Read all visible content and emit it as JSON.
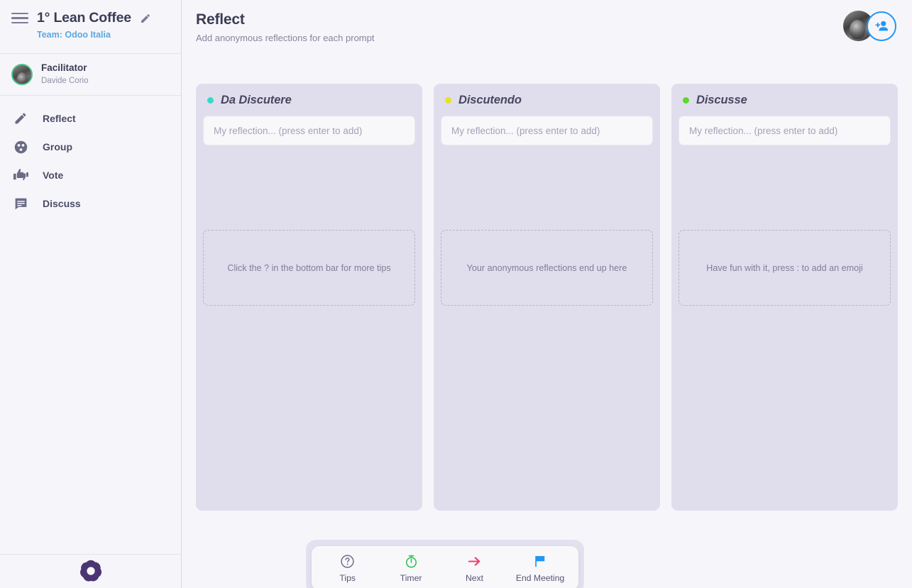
{
  "sidebar": {
    "menu_icon": "hamburger-icon",
    "meeting_title": "1° Lean Coffee",
    "edit_icon": "pencil-icon",
    "team_label": "Team: Odoo Italia",
    "facilitator": {
      "role": "Facilitator",
      "name": "Davide Corio",
      "avatar": "user-avatar"
    },
    "nav_items": [
      {
        "label": "Reflect",
        "icon": "pencil-icon"
      },
      {
        "label": "Group",
        "icon": "group-circles-icon"
      },
      {
        "label": "Vote",
        "icon": "thumbs-icon"
      },
      {
        "label": "Discuss",
        "icon": "chat-bubble-icon"
      }
    ],
    "logo": "rosette-logo"
  },
  "header": {
    "title": "Reflect",
    "subtitle": "Add anonymous reflections for each prompt",
    "avatar": "user-avatar",
    "add_person_icon": "add-person-icon"
  },
  "board": {
    "columns": [
      {
        "title": "Da Discutere",
        "dot_color": "#3ad9c8",
        "input_placeholder": "My reflection... (press enter to add)",
        "input_value": "",
        "hint": "Click the ? in the bottom bar for more tips"
      },
      {
        "title": "Discutendo",
        "dot_color": "#e8e220",
        "input_placeholder": "My reflection... (press enter to add)",
        "input_value": "",
        "hint": "Your anonymous reflections end up here"
      },
      {
        "title": "Discusse",
        "dot_color": "#5dd82a",
        "input_placeholder": "My reflection... (press enter to add)",
        "input_value": "",
        "hint": "Have fun with it, press : to add an emoji"
      }
    ]
  },
  "bottombar": {
    "items": [
      {
        "label": "Tips",
        "icon": "question-circle-icon",
        "color": "#6d6d88"
      },
      {
        "label": "Timer",
        "icon": "stopwatch-icon",
        "color": "#2fc44f"
      },
      {
        "label": "Next",
        "icon": "arrow-right-icon",
        "color": "#ef3f6e"
      },
      {
        "label": "End Meeting",
        "icon": "flag-icon",
        "color": "#2196f3"
      }
    ]
  },
  "colors": {
    "sidebar_bg": "#f6f6fa",
    "column_bg": "#e0deed",
    "accent_blue": "#2196f3",
    "team_link": "#5aa8e0",
    "title_text": "#3b3b56"
  }
}
